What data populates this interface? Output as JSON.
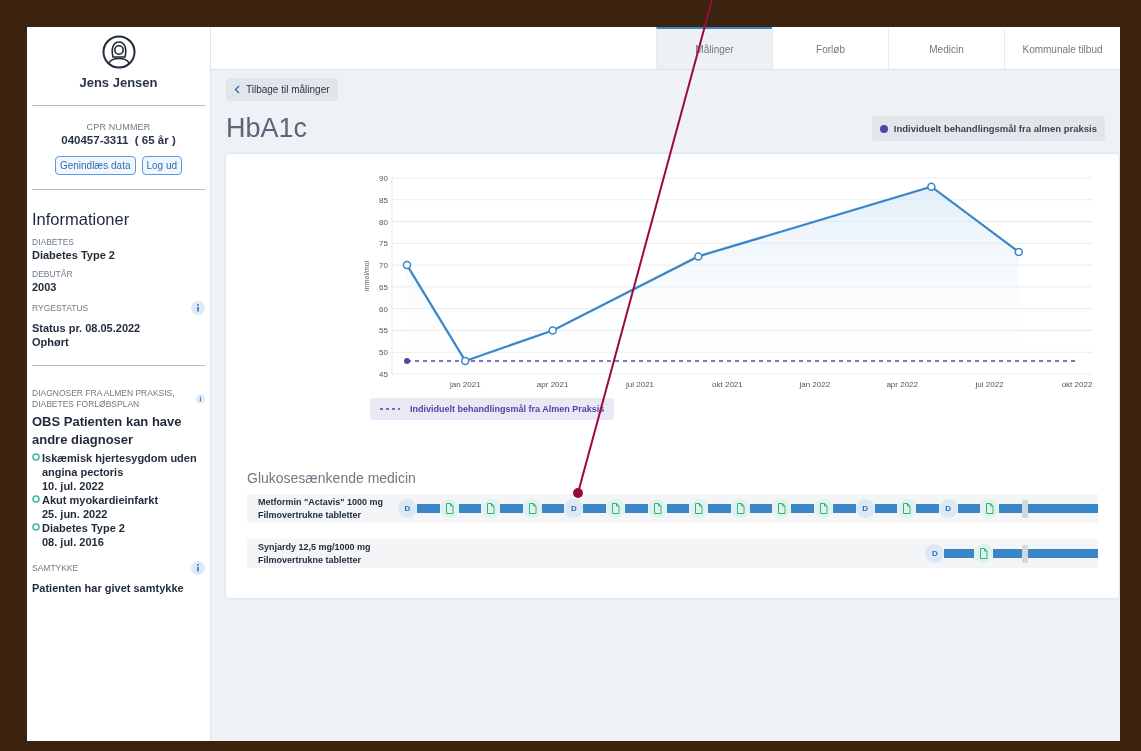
{
  "patient": {
    "name": "Jens Jensen",
    "cpr_label": "CPR NUMMER",
    "cpr": "040457-3311  ( 65 år )",
    "buttons": [
      "Genindlæs data",
      "Log ud"
    ]
  },
  "info": {
    "title": "Informationer",
    "sections": [
      {
        "kind": "plain",
        "label": "DIABETES",
        "lines": [
          "Diabetes Type 2"
        ],
        "info": false
      },
      {
        "kind": "plain",
        "label": "DEBUTÅR",
        "lines": [
          "2003"
        ],
        "info": false
      },
      {
        "kind": "plain",
        "label": "RYGESTATUS",
        "lines": [
          "Status pr. 08.05.2022",
          "Ophørt"
        ],
        "info": true,
        "divider": true
      },
      {
        "kind": "diagnoses",
        "label": "DIAGNOSER FRA ALMEN PRAKSIS, DIABETES FORLØBSPLAN",
        "info": true,
        "note": "OBS Patienten kan have andre diagnoser",
        "items": [
          {
            "name": "Iskæmisk hjertesygdom uden angina pectoris",
            "date": "10. jul. 2022"
          },
          {
            "name": "Akut myokardieinfarkt",
            "date": "25. jun. 2022"
          },
          {
            "name": "Diabetes Type 2",
            "date": "08. jul. 2016"
          }
        ]
      },
      {
        "kind": "plain",
        "label": "SAMTYKKE",
        "lines": [
          "Patienten har givet samtykke"
        ],
        "info": true
      }
    ]
  },
  "tabs": [
    {
      "label": "Målinger",
      "selected": true
    },
    {
      "label": "Forløb",
      "selected": false
    },
    {
      "label": "Medicin",
      "selected": false
    },
    {
      "label": "Kommunale tilbud",
      "selected": false
    }
  ],
  "back_button": "Tilbage til målinger",
  "title": "HbA1c",
  "goal_badge": {
    "label": "Individuelt behandlingsmål fra almen praksis",
    "color": "#4b48a6"
  },
  "chart": {
    "chart_data": {
      "type": "line",
      "ylabel": "mmol/mol",
      "grid": true,
      "categories": [
        null,
        null,
        "jan 2021",
        null,
        null,
        "apr 2021",
        null,
        null,
        "jul 2021",
        null,
        null,
        "okt 2021",
        null,
        null,
        "jan 2022",
        null,
        null,
        "apr 2022",
        null,
        null,
        "jul 2022",
        null,
        null,
        "okt 2022"
      ],
      "series": [
        {
          "type": "area",
          "color": "#3a86c8",
          "marker": "circle",
          "values": [
            70,
            null,
            48,
            null,
            null,
            55,
            null,
            null,
            null,
            null,
            72,
            null,
            null,
            null,
            null,
            null,
            null,
            null,
            88,
            null,
            null,
            73,
            null,
            null
          ]
        },
        {
          "type": "line",
          "name": "Individuelt behandlingsmål fra Almen Praksis",
          "color": "#4b48a6",
          "line_style": "dashed",
          "values": [
            48,
            48,
            48,
            48,
            48,
            48,
            48,
            48,
            48,
            48,
            48,
            48,
            48,
            48,
            48,
            48,
            48,
            48,
            48,
            48,
            48,
            48,
            48,
            48
          ]
        }
      ],
      "ylim": [
        45,
        90
      ],
      "yticks": [
        45,
        50,
        55,
        60,
        65,
        70,
        75,
        80,
        85,
        90
      ]
    }
  },
  "medicine": {
    "title": "Glukosesænkende medicin",
    "rows": [
      {
        "name": "Metformin \"Actavis\" 1000 mg",
        "form": "Filmovertrukne tabletter",
        "events": [
          {
            "kind": "dose",
            "label": "D"
          },
          {
            "kind": "doc"
          },
          {
            "kind": "doc"
          },
          {
            "kind": "doc"
          },
          {
            "kind": "dose",
            "label": "D"
          },
          {
            "kind": "doc"
          },
          {
            "kind": "doc"
          },
          {
            "kind": "doc"
          },
          {
            "kind": "doc"
          },
          {
            "kind": "doc"
          },
          {
            "kind": "doc"
          },
          {
            "kind": "dose",
            "label": "D"
          },
          {
            "kind": "doc"
          },
          {
            "kind": "dose",
            "label": "D"
          },
          {
            "kind": "doc"
          },
          {
            "kind": "handle"
          }
        ]
      },
      {
        "name": "Synjardy 12,5 mg/1000 mg",
        "form": "Filmovertrukne tabletter",
        "events": [
          {
            "kind": "empty"
          },
          {
            "kind": "dose",
            "label": "D"
          },
          {
            "kind": "doc"
          },
          {
            "kind": "handle"
          }
        ]
      }
    ]
  }
}
